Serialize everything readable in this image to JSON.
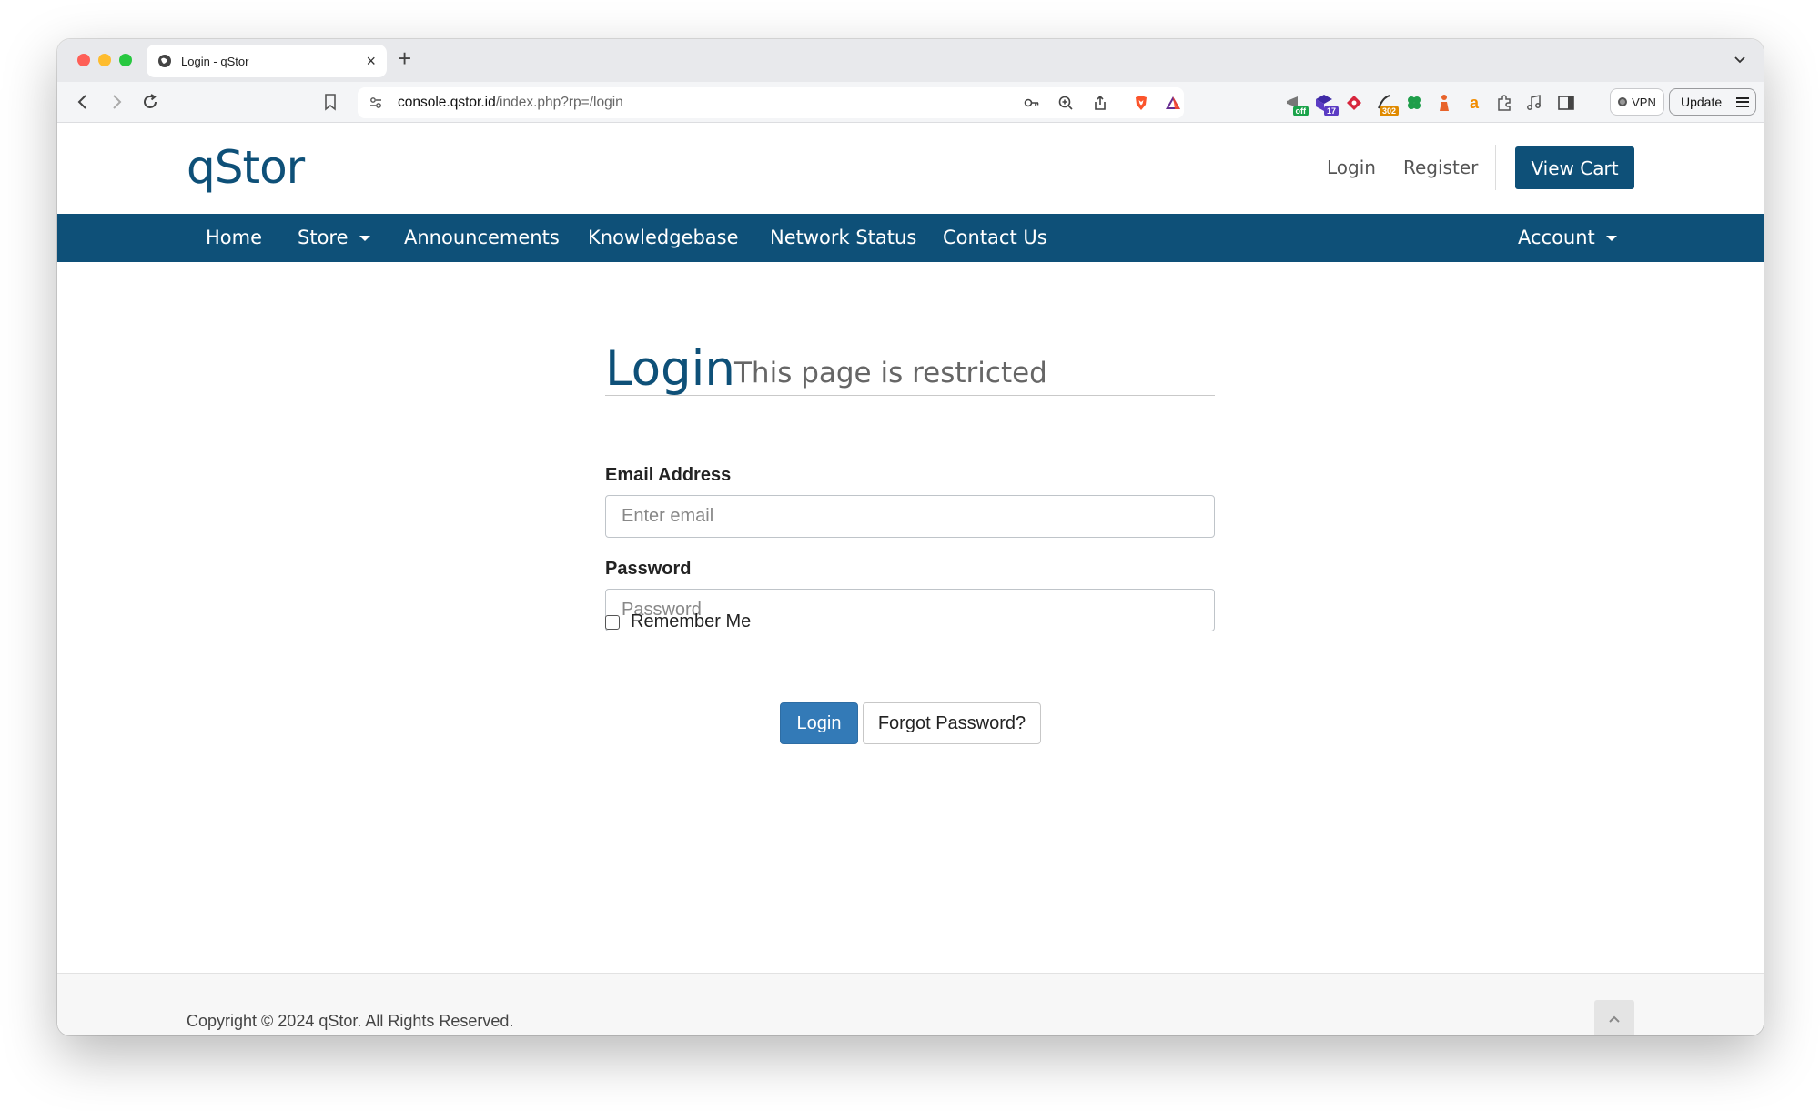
{
  "browser": {
    "tab_title": "Login - qStor",
    "new_tab_label": "+",
    "tab_close_label": "×",
    "url_host": "console.qstor.id",
    "url_path": "/index.php?rp=/login",
    "extensions": [
      {
        "icon": "megaphone-extension-icon",
        "badge": "off",
        "badge_color": "#1aa34a"
      },
      {
        "icon": "cube-extension-icon",
        "badge": "17",
        "badge_color": "#5b3cc4"
      },
      {
        "icon": "diamond-extension-icon",
        "badge": "",
        "badge_color": ""
      },
      {
        "icon": "redirect-extension-icon",
        "badge": "302",
        "badge_color": "#e08a00"
      },
      {
        "icon": "clover-extension-icon",
        "badge": "",
        "badge_color": ""
      },
      {
        "icon": "figure-extension-icon",
        "badge": "",
        "badge_color": ""
      },
      {
        "icon": "letter-a-extension-icon",
        "badge": "",
        "badge_color": ""
      }
    ],
    "vpn_label": "VPN",
    "update_label": "Update"
  },
  "site": {
    "logo": "qStor",
    "top_links": {
      "login": "Login",
      "register": "Register"
    },
    "view_cart": "View Cart",
    "nav": {
      "home": "Home",
      "store": "Store",
      "announcements": "Announcements",
      "knowledgebase": "Knowledgebase",
      "network_status": "Network Status",
      "contact_us": "Contact Us",
      "account": "Account"
    },
    "accent_color": "#0e5078"
  },
  "login": {
    "title": "Login",
    "subtitle": "This page is restricted",
    "email_label": "Email Address",
    "email_placeholder": "Enter email",
    "email_value": "",
    "password_label": "Password",
    "password_placeholder": "Password",
    "password_value": "",
    "remember_label": "Remember Me",
    "remember_checked": false,
    "login_button": "Login",
    "forgot_button": "Forgot Password?"
  },
  "footer": {
    "copyright": "Copyright © 2024 qStor. All Rights Reserved."
  }
}
